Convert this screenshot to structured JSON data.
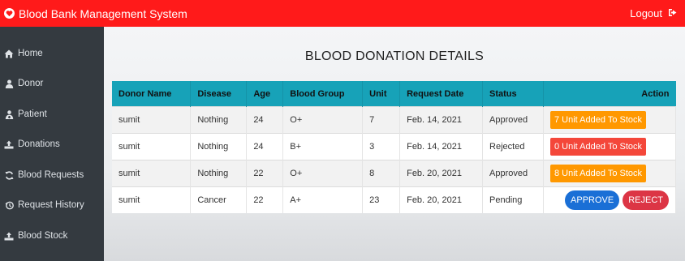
{
  "header": {
    "brand": "Blood Bank Management System",
    "brand_icon": "heart-icon",
    "logout_label": "Logout",
    "logout_icon": "sign-out-icon",
    "color": "#ff1a1a"
  },
  "sidebar": {
    "items": [
      {
        "label": "Home",
        "icon": "home-icon"
      },
      {
        "label": "Donor",
        "icon": "user-icon"
      },
      {
        "label": "Patient",
        "icon": "patient-icon"
      },
      {
        "label": "Donations",
        "icon": "donate-icon"
      },
      {
        "label": "Blood Requests",
        "icon": "sync-icon"
      },
      {
        "label": "Request History",
        "icon": "history-icon"
      },
      {
        "label": "Blood Stock",
        "icon": "stock-icon"
      }
    ]
  },
  "main": {
    "title": "BLOOD DONATION DETAILS",
    "columns": [
      "Donor Name",
      "Disease",
      "Age",
      "Blood Group",
      "Unit",
      "Request Date",
      "Status",
      "Action"
    ],
    "rows": [
      {
        "name": "sumit",
        "disease": "Nothing",
        "age": "24",
        "group": "O+",
        "unit": "7",
        "date": "Feb. 14, 2021",
        "status": "Approved",
        "action": {
          "text": "7 Unit Added To Stock",
          "color": "#ff9800"
        }
      },
      {
        "name": "sumit",
        "disease": "Nothing",
        "age": "24",
        "group": "B+",
        "unit": "3",
        "date": "Feb. 14, 2021",
        "status": "Rejected",
        "action": {
          "text": "0 Unit Added To Stock",
          "color": "#f4473a"
        }
      },
      {
        "name": "sumit",
        "disease": "Nothing",
        "age": "22",
        "group": "O+",
        "unit": "8",
        "date": "Feb. 20, 2021",
        "status": "Approved",
        "action": {
          "text": "8 Unit Added To Stock",
          "color": "#ff9800"
        }
      },
      {
        "name": "sumit",
        "disease": "Cancer",
        "age": "22",
        "group": "A+",
        "unit": "23",
        "date": "Feb. 20, 2021",
        "status": "Pending",
        "action": null
      }
    ],
    "approve_label": "APPROVE",
    "reject_label": "REJECT",
    "approve_color": "#1a6fd6",
    "reject_color": "#dc3545",
    "header_color": "#17a2b8"
  }
}
